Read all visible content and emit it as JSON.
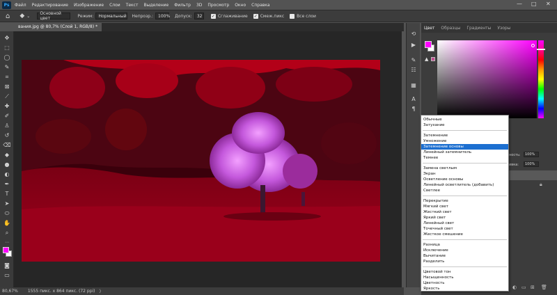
{
  "menubar": {
    "logo": "Ps",
    "items": [
      "Файл",
      "Редактирование",
      "Изображение",
      "Слои",
      "Текст",
      "Выделение",
      "Фильтр",
      "3D",
      "Просмотр",
      "Окно",
      "Справка"
    ],
    "window_controls": [
      "—",
      "□",
      "✕"
    ]
  },
  "options": {
    "preset": "Основной цвет",
    "mode_label": "Режим:",
    "mode_value": "Нормальный",
    "opacity_label": "Непрозр.:",
    "opacity_value": "100%",
    "tolerance_label": "Допуск:",
    "tolerance_value": "32",
    "antialias_label": "Сглаживание",
    "contiguous_label": "Смеж.пикс",
    "all_layers_label": "Все слои"
  },
  "document": {
    "tab_title": "вания.jpg @ 80,7% (Слой 1, RGB/8) *"
  },
  "status": {
    "zoom": "80,67%",
    "info": "1555 пикс. x 864 пикс. (72 ppi)",
    "arrow": "〉"
  },
  "panel": {
    "tabs": [
      "Цвет",
      "Образцы",
      "Градиенты",
      "Узоры"
    ],
    "active_tab": "Цвет",
    "fg_color": "#ff00ff",
    "bg_color": "#ffffff",
    "layers": {
      "opacity_label": "ность:",
      "opacity_value": "100%",
      "fill_label": "ивка:",
      "fill_value": "100%"
    }
  },
  "blend_menu": {
    "groups": [
      [
        "Обычные",
        "Затухание"
      ],
      [
        "Затемнение",
        "Умножение",
        "Затемнение основы",
        "Линейный затемнитель",
        "Темнее"
      ],
      [
        "Замена светлым",
        "Экран",
        "Осветление основы",
        "Линейный осветлитель (добавить)",
        "Светлее"
      ],
      [
        "Перекрытие",
        "Мягкий свет",
        "Жесткий свет",
        "Яркий свет",
        "Линейный свет",
        "Точечный свет",
        "Жесткое смешение"
      ],
      [
        "Разница",
        "Исключение",
        "Вычитание",
        "Разделить"
      ],
      [
        "Цветовой тон",
        "Насыщенность",
        "Цветность",
        "Яркость"
      ]
    ],
    "selected": "Затемнение основы"
  }
}
